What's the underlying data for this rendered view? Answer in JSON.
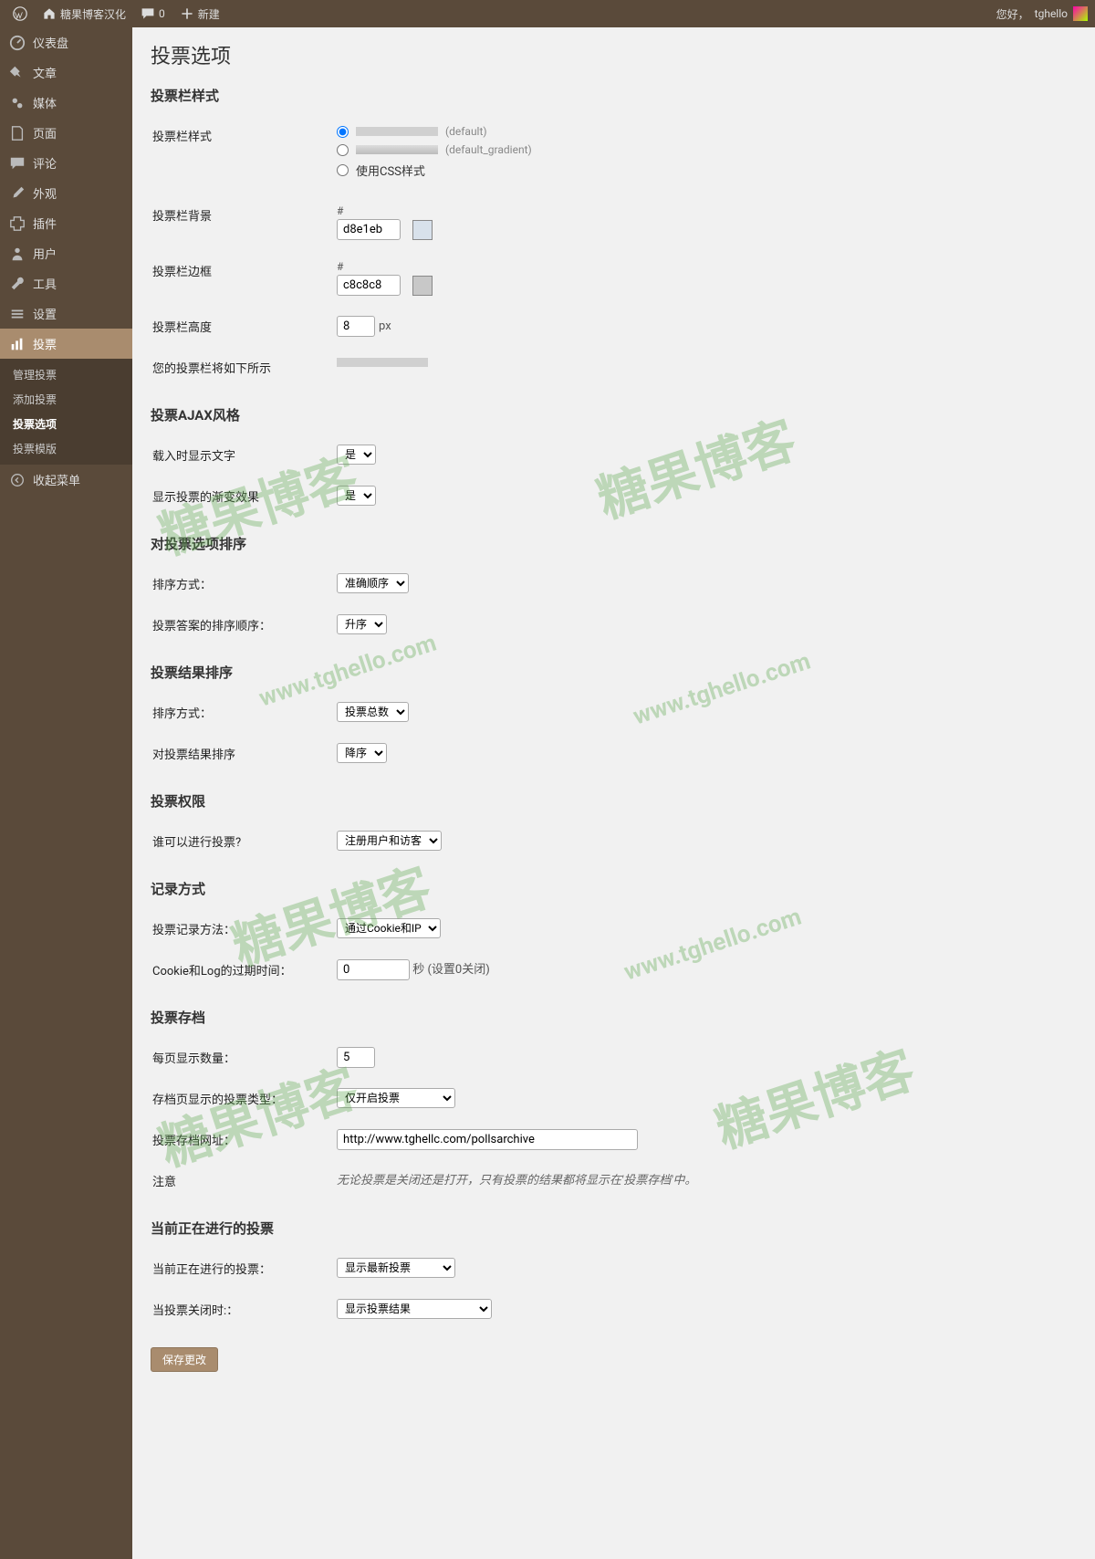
{
  "adminbar": {
    "site": "糖果博客汉化",
    "comments": "0",
    "new": "新建",
    "greeting": "您好，",
    "user": "tghello"
  },
  "menu": {
    "dashboard": "仪表盘",
    "posts": "文章",
    "media": "媒体",
    "pages": "页面",
    "comments": "评论",
    "appearance": "外观",
    "plugins": "插件",
    "users": "用户",
    "tools": "工具",
    "settings": "设置",
    "polls": "投票",
    "sub": {
      "manage": "管理投票",
      "add": "添加投票",
      "options": "投票选项",
      "templates": "投票模版"
    },
    "collapse": "收起菜单"
  },
  "page": {
    "title": "投票选项",
    "sec_barstyle": "投票栏样式",
    "lbl_barstyle": "投票栏样式",
    "opt_default": "(default)",
    "opt_default_gradient": "(default_gradient)",
    "opt_css": "使用CSS样式",
    "lbl_barbg": "投票栏背景",
    "val_barbg": "d8e1eb",
    "swatch_barbg": "#d8e1eb",
    "lbl_barborder": "投票栏边框",
    "val_barborder": "c8c8c8",
    "swatch_barborder": "#c8c8c8",
    "lbl_barheight": "投票栏高度",
    "val_barheight": "8",
    "px": "px",
    "lbl_preview": "您的投票栏将如下所示",
    "sec_ajax": "投票AJAX风格",
    "lbl_loadingtext": "载入时显示文字",
    "lbl_fade": "显示投票的渐变效果",
    "opt_yes": "是",
    "sec_sortans": "对投票选项排序",
    "lbl_sortby": "排序方式：",
    "val_sortby": "准确顺序",
    "lbl_sortorder": "投票答案的排序顺序：",
    "val_asc": "升序",
    "sec_sortres": "投票结果排序",
    "lbl_res_sortby": "排序方式：",
    "val_res_sortby": "投票总数",
    "lbl_res_sortorder": "对投票结果排序",
    "val_desc": "降序",
    "sec_perm": "投票权限",
    "lbl_who": "谁可以进行投票?",
    "val_who": "注册用户和访客",
    "sec_log": "记录方式",
    "lbl_logmethod": "投票记录方法：",
    "val_logmethod": "通过Cookie和IP",
    "lbl_expiry": "Cookie和Log的过期时间：",
    "val_expiry": "0",
    "expiry_desc": "秒  (设置0关闭)",
    "sec_archive": "投票存档",
    "lbl_perpage": "每页显示数量：",
    "val_perpage": "5",
    "lbl_arch_type": "存档页显示的投票类型：",
    "val_arch_type": "仅开启投票",
    "lbl_arch_url": "投票存档网址：",
    "val_arch_url": "http://www.tghellc.com/pollsarchive",
    "lbl_note": "注意",
    "note_text": "无论投票是关闭还是打开，只有投票的结果都将显示在'投票存档'中。",
    "sec_current": "当前正在进行的投票",
    "lbl_current": "当前正在进行的投票：",
    "val_current": "显示最新投票",
    "lbl_closed": "当投票关闭时:：",
    "val_closed": "显示投票结果",
    "btn_save": "保存更改"
  },
  "watermark": {
    "cn": "糖果博客",
    "url": "www.tghello.com"
  }
}
